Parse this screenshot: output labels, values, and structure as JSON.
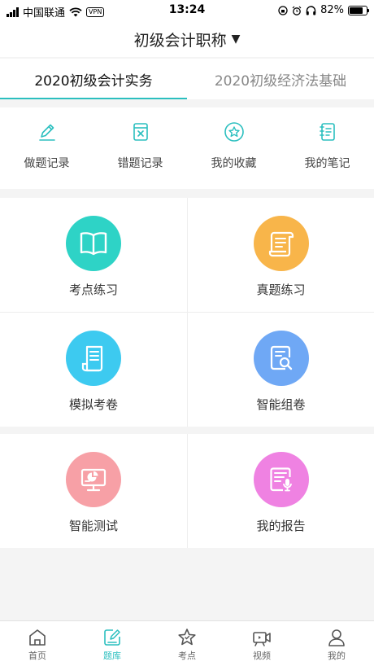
{
  "status_bar": {
    "carrier": "中国联通",
    "vpn": "VPN",
    "time": "13:24",
    "battery": "82%"
  },
  "header": {
    "title": "初级会计职称",
    "caret": "▼"
  },
  "tabs": [
    {
      "label": "2020初级会计实务",
      "active": true
    },
    {
      "label": "2020初级经济法基础",
      "active": false
    }
  ],
  "quick_actions": [
    {
      "label": "做题记录",
      "icon": "pencil-icon"
    },
    {
      "label": "错题记录",
      "icon": "wrong-questions-icon"
    },
    {
      "label": "我的收藏",
      "icon": "star-icon"
    },
    {
      "label": "我的笔记",
      "icon": "notebook-icon"
    }
  ],
  "modules": [
    {
      "label": "考点练习",
      "icon": "open-book-icon",
      "color": "#2ed3c6"
    },
    {
      "label": "真题练习",
      "icon": "scroll-icon",
      "color": "#f8b54a"
    },
    {
      "label": "模拟考卷",
      "icon": "document-icon",
      "color": "#3dcaf0"
    },
    {
      "label": "智能组卷",
      "icon": "document-search-icon",
      "color": "#6fa8f5"
    },
    {
      "label": "智能测试",
      "icon": "monitor-chart-icon",
      "color": "#f7a0a6"
    },
    {
      "label": "我的报告",
      "icon": "report-microphone-icon",
      "color": "#ef82e2"
    }
  ],
  "bottom_nav": [
    {
      "label": "首页",
      "icon": "home-icon",
      "active": false
    },
    {
      "label": "题库",
      "icon": "question-bank-icon",
      "active": true
    },
    {
      "label": "考点",
      "icon": "star-outline-icon",
      "active": false
    },
    {
      "label": "视频",
      "icon": "video-camera-icon",
      "active": false
    },
    {
      "label": "我的",
      "icon": "user-icon",
      "active": false
    }
  ],
  "colors": {
    "accent": "#2bbfbf",
    "inactive_icon": "#666666"
  }
}
